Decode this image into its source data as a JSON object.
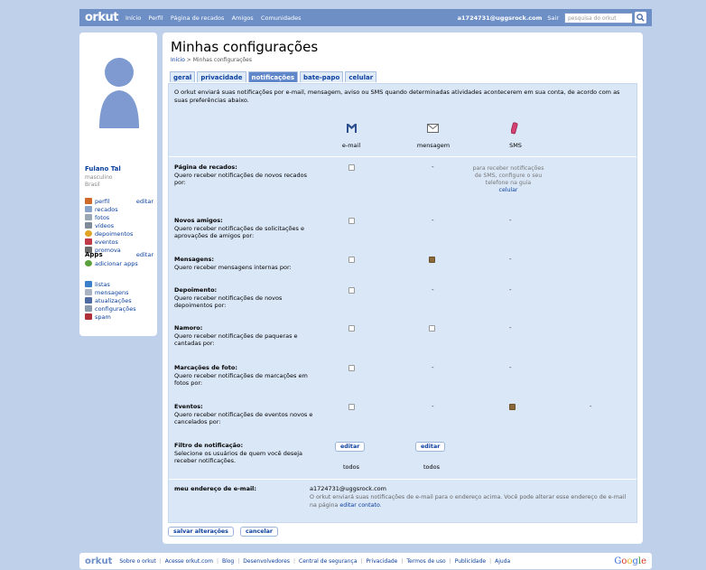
{
  "topbar": {
    "logo": "orkut",
    "nav": [
      "Início",
      "Perfil",
      "Página de recados",
      "Amigos",
      "Comunidades"
    ],
    "email": "a1724731@uggsrock.com",
    "sair": "Sair",
    "search_placeholder": "pesquisa do orkut"
  },
  "profile": {
    "name": "Fulano Tal",
    "gender": "masculino",
    "country": "Brasil"
  },
  "sidebar": {
    "edit": "editar",
    "items": [
      "perfil",
      "recados",
      "fotos",
      "vídeos",
      "depoimentos",
      "eventos",
      "promova"
    ],
    "apps_title": "Apps",
    "apps_edit": "editar",
    "apps_add": "adicionar apps",
    "bottom": [
      "listas",
      "mensagens",
      "atualizações",
      "configurações",
      "spam"
    ]
  },
  "main": {
    "title": "Minhas configurações",
    "crumb_home": "Início",
    "crumb_sep": " > ",
    "crumb_current": "Minhas configurações",
    "tabs": [
      "geral",
      "privacidade",
      "notificações",
      "bate-papo",
      "celular"
    ],
    "intro": "O orkut enviará suas notificações por e-mail, mensagem, aviso ou SMS quando determinadas atividades acontecerem em sua conta, de acordo com as suas preferências abaixo.",
    "col_email": "e-mail",
    "col_msg": "mensagem",
    "col_sms": "SMS",
    "sms_note": "para receber notificações de SMS, configure o seu telefone na guia",
    "sms_link": "celular",
    "rows": [
      {
        "title": "Página de recados:",
        "desc": "Quero receber notificações de novos recados por:"
      },
      {
        "title": "Novos amigos:",
        "desc": "Quero receber notificações de solicitações e aprovações de amigos por:"
      },
      {
        "title": "Mensagens:",
        "desc": "Quero receber mensagens internas por:"
      },
      {
        "title": "Depoimento:",
        "desc": "Quero receber notificações de novos depoimentos por:"
      },
      {
        "title": "Namoro:",
        "desc": "Quero receber notificações de paqueras e cantadas por:"
      },
      {
        "title": "Marcações de foto:",
        "desc": "Quero receber notificações de marcações em fotos por:"
      },
      {
        "title": "Eventos:",
        "desc": "Quero receber notificações de eventos novos e cancelados por:"
      }
    ],
    "dash": "-",
    "filter_title": "Filtro de notificação:",
    "filter_desc": "Selecione os usuários de quem você deseja receber notificações.",
    "edit_label": "editar",
    "todos": "todos",
    "email_label": "meu endereço de e-mail:",
    "email_value": "a1724731@uggsrock.com",
    "email_note": "O orkut enviará suas notificações de e-mail para o endereço acima. Você pode alterar esse endereço de e-mail na página",
    "email_link": "editar contato",
    "email_end": ".",
    "save": "salvar alterações",
    "cancel": "cancelar"
  },
  "footer": {
    "logo": "orkut",
    "links": [
      "Sobre o orkut",
      "Acesse orkut.com",
      "Blog",
      "Desenvolvedores",
      "Central de segurança",
      "Privacidade",
      "Termos de uso",
      "Publicidade",
      "Ajuda"
    ],
    "google": "Google"
  },
  "colors": {
    "accent": "#6d8fc6",
    "panel": "#dae7f7",
    "link": "#0a3f9e",
    "logo_dot": "#e8207f"
  }
}
